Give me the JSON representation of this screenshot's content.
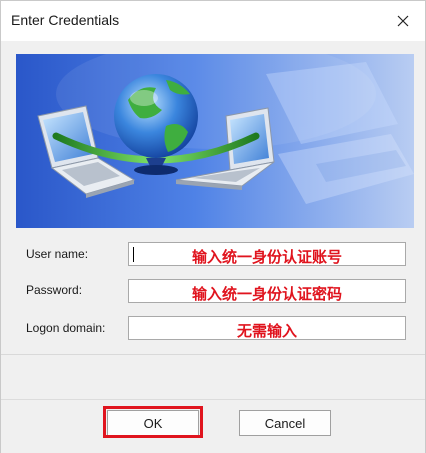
{
  "window": {
    "title": "Enter Credentials"
  },
  "banner": {
    "icon": "network-globe-laptops-illustration"
  },
  "form": {
    "username_label": "User name:",
    "username_hint": "输入统一身份认证账号",
    "password_label": "Password:",
    "password_hint": "输入统一身份认证密码",
    "domain_label": "Logon domain:",
    "domain_hint": "无需输入"
  },
  "buttons": {
    "ok_label": "OK",
    "cancel_label": "Cancel"
  },
  "colors": {
    "annotation": "#e0141e",
    "banner_blue": "#2f5fd0"
  }
}
